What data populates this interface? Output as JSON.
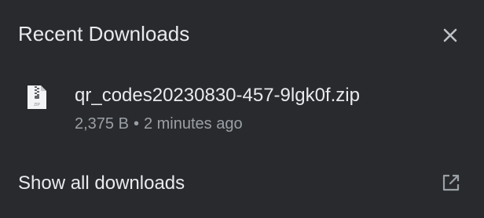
{
  "header": {
    "title": "Recent Downloads",
    "close_icon": "close-icon"
  },
  "downloads": [
    {
      "file_icon": "zip-file-icon",
      "icon_caption": "ZIP",
      "filename": "qr_codes20230830-457-9lgk0f.zip",
      "size": "2,375 B",
      "separator": "•",
      "time": "2 minutes ago"
    }
  ],
  "footer": {
    "show_all_label": "Show all downloads",
    "external_icon": "open-in-new-icon"
  },
  "colors": {
    "background": "#292a2d",
    "primary_text": "#e8eaed",
    "secondary_text": "#9aa0a6"
  }
}
